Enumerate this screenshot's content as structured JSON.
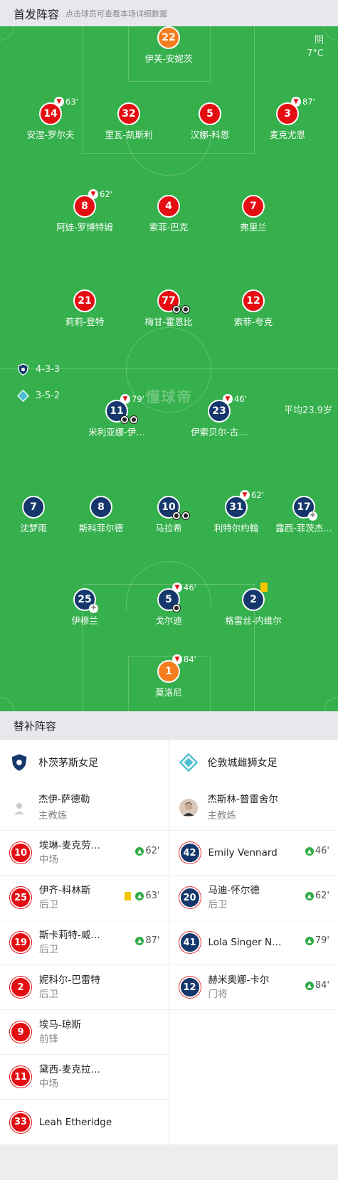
{
  "header": {
    "title": "首发阵容",
    "hint": "点击球员可查看本场详细数据"
  },
  "weather": {
    "condition": "阴",
    "temp": "7°C"
  },
  "watermark": "懂球帝",
  "home_formation": "4-3-3",
  "away_formation": "3-5-2",
  "avg_age": "平均23.9岁",
  "home_players": [
    {
      "num": "22",
      "name": "伊芙-安妮茨"
    },
    {
      "num": "14",
      "name": "安涅-罗尔夫",
      "sub": "63'"
    },
    {
      "num": "32",
      "name": "里瓦-凯斯利"
    },
    {
      "num": "5",
      "name": "汉娜-科恩"
    },
    {
      "num": "3",
      "name": "麦克尤恩",
      "sub": "87'"
    },
    {
      "num": "8",
      "name": "阿娃-罗博特姆",
      "sub": "62'"
    },
    {
      "num": "4",
      "name": "索菲-巴克"
    },
    {
      "num": "7",
      "name": "弗里兰"
    },
    {
      "num": "21",
      "name": "莉莉-登特"
    },
    {
      "num": "77",
      "name": "梅甘-霍恩比"
    },
    {
      "num": "12",
      "name": "索菲-夸克"
    }
  ],
  "away_players": [
    {
      "num": "11",
      "name": "米利亚娜-伊…",
      "sub": "79'"
    },
    {
      "num": "23",
      "name": "伊索贝尔-古…",
      "sub": "46'"
    },
    {
      "num": "7",
      "name": "沈梦雨"
    },
    {
      "num": "8",
      "name": "斯科菲尔德"
    },
    {
      "num": "10",
      "name": "马拉希"
    },
    {
      "num": "31",
      "name": "利特尔约翰",
      "sub": "62'"
    },
    {
      "num": "17",
      "name": "露西-菲茨杰…"
    },
    {
      "num": "25",
      "name": "伊穆兰"
    },
    {
      "num": "5",
      "name": "戈尔迪",
      "sub": "46'"
    },
    {
      "num": "2",
      "name": "格雷丝-内维尔"
    },
    {
      "num": "1",
      "name": "莫洛尼",
      "sub": "84'"
    }
  ],
  "subs_title": "替补阵容",
  "home_team": "朴茨茅斯女足",
  "away_team": "伦敦城雌狮女足",
  "home_coach": {
    "name": "杰伊-萨德勒",
    "role": "主教练"
  },
  "away_coach": {
    "name": "杰斯林-普雷舍尔",
    "role": "主教练"
  },
  "home_subs": [
    {
      "num": "10",
      "name": "埃琳-麦克劳…",
      "pos": "中场",
      "in": "62'"
    },
    {
      "num": "25",
      "name": "伊齐-科林斯",
      "pos": "后卫",
      "in": "63'"
    },
    {
      "num": "19",
      "name": "斯卡莉特-威…",
      "pos": "后卫",
      "in": "87'"
    },
    {
      "num": "2",
      "name": "妮科尔-巴雷特",
      "pos": "后卫"
    },
    {
      "num": "9",
      "name": "埃马-琼斯",
      "pos": "前锋"
    },
    {
      "num": "11",
      "name": "黛西-麦克拉…",
      "pos": "中场"
    },
    {
      "num": "33",
      "name": "Leah Etheridge",
      "pos": ""
    }
  ],
  "away_subs": [
    {
      "num": "42",
      "name": "Emily Vennard",
      "pos": "",
      "in": "46'"
    },
    {
      "num": "20",
      "name": "马迪-怀尔德",
      "pos": "后卫",
      "in": "62'"
    },
    {
      "num": "41",
      "name": "Lola Singer N…",
      "pos": "",
      "in": "79'"
    },
    {
      "num": "12",
      "name": "赫米奥娜-卡尔",
      "pos": "门将",
      "in": "84'"
    }
  ],
  "colors": {
    "pitch": "#35b04c",
    "home": "#e30d12",
    "keeper_home": "#f57d1e",
    "away": "#15376b"
  }
}
